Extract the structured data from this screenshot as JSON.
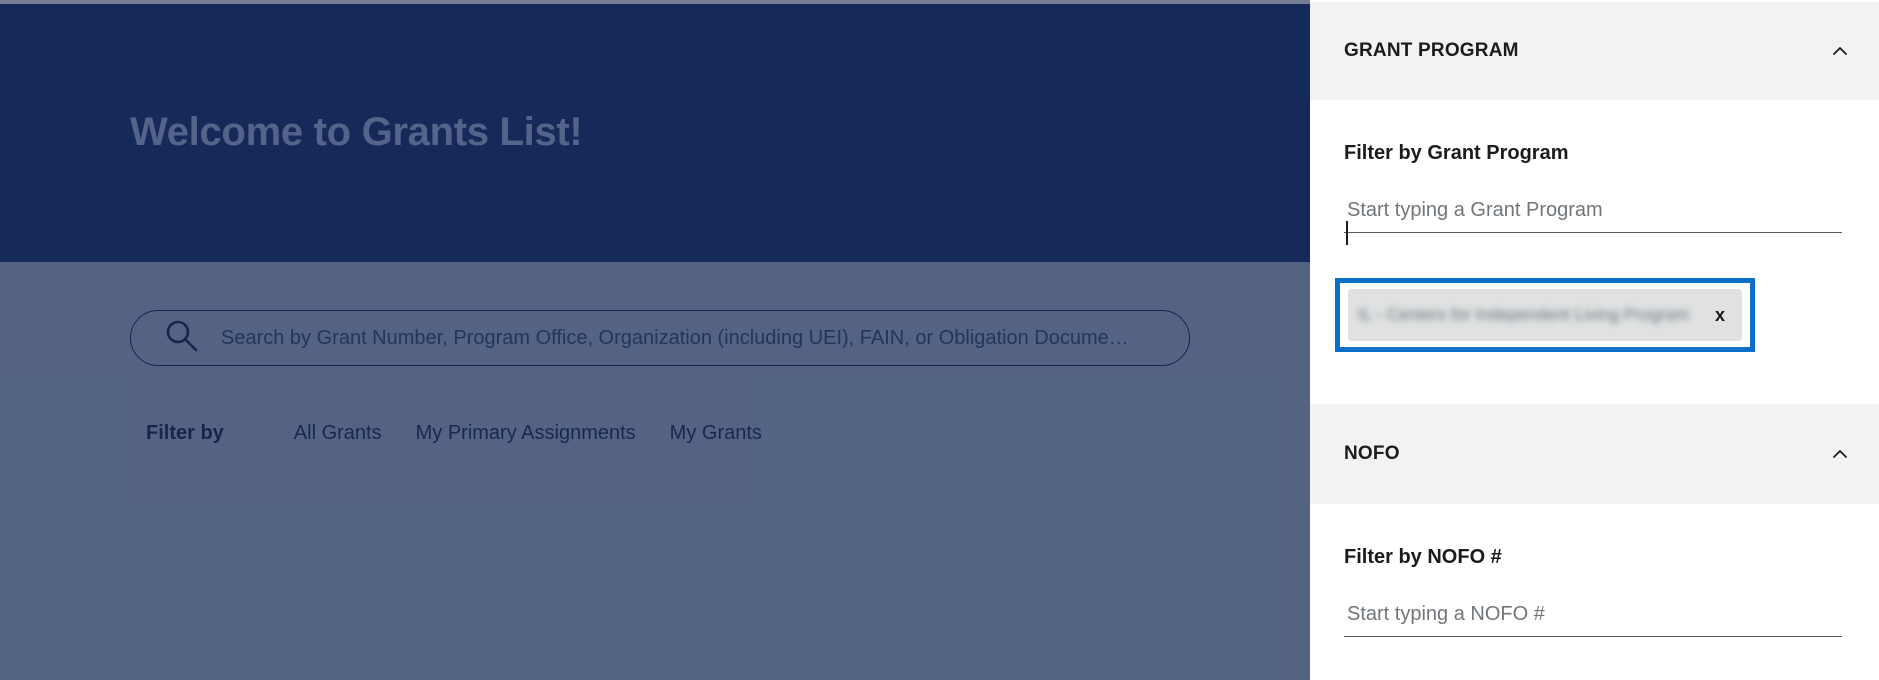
{
  "hero": {
    "title": "Welcome to Grants List!"
  },
  "search": {
    "placeholder": "Search by Grant Number, Program Office, Organization (including UEI), FAIN, or Obligation Docume…"
  },
  "filter_bar": {
    "label": "Filter by",
    "tabs": [
      {
        "label": "All Grants"
      },
      {
        "label": "My Primary Assignments"
      },
      {
        "label": "My Grants"
      }
    ]
  },
  "drawer": {
    "grant_program": {
      "title": "GRANT PROGRAM",
      "field_label": "Filter by Grant Program",
      "placeholder": "Start typing a Grant Program",
      "selected_chip": {
        "text": "IL - Centers for Independent Living Program",
        "remove": "x"
      }
    },
    "nofo": {
      "title": "NOFO",
      "field_label": "Filter by NOFO #",
      "placeholder": "Start typing a NOFO #"
    }
  },
  "colors": {
    "hero_bg": "#1a3368",
    "overlay": "#112048",
    "focus_ring": "#0b6fc9",
    "section_header_bg": "#f1f2f4",
    "chip_bg": "#dfe1e2"
  }
}
